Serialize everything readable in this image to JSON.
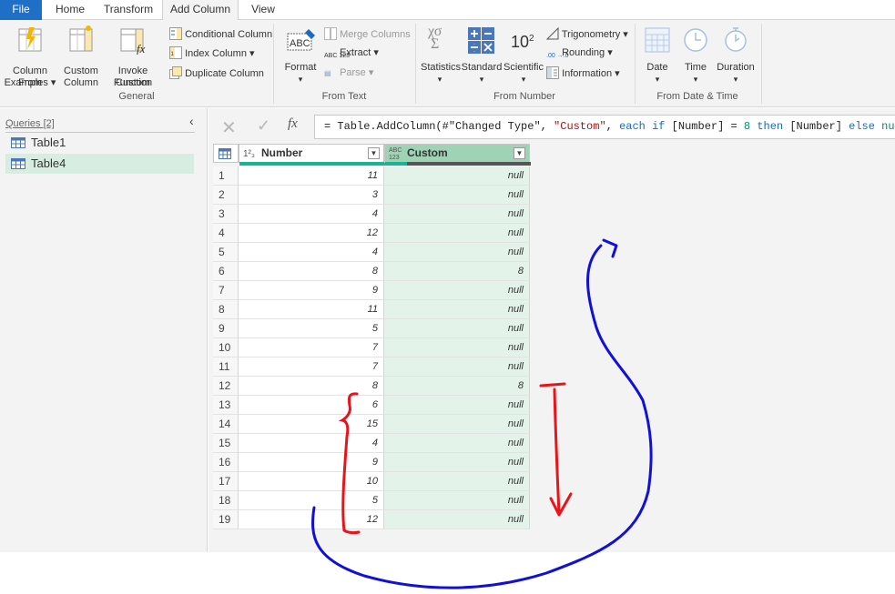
{
  "menu": {
    "tabs": [
      "File",
      "Home",
      "Transform",
      "Add Column",
      "View"
    ]
  },
  "ribbon": {
    "general": {
      "group_label": "General",
      "column_from_examples": [
        "Column From",
        "Examples ▾"
      ],
      "custom_column": [
        "Custom",
        "Column"
      ],
      "invoke_custom_function": [
        "Invoke Custom",
        "Function"
      ],
      "conditional_column": "Conditional Column",
      "index_column": "Index Column ▾",
      "duplicate_column": "Duplicate Column"
    },
    "from_text": {
      "group_label": "From Text",
      "format": "Format",
      "merge_columns": "Merge Columns",
      "extract": "Extract ▾",
      "parse": "Parse ▾"
    },
    "from_number": {
      "group_label": "From Number",
      "statistics": "Statistics",
      "standard": "Standard",
      "scientific": "Scientific",
      "trigonometry": "Trigonometry ▾",
      "rounding": "Rounding ▾",
      "information": "Information ▾"
    },
    "from_date_time": {
      "group_label": "From Date & Time",
      "date": "Date",
      "time": "Time",
      "duration": "Duration"
    }
  },
  "queries": {
    "title": "Queries [2]",
    "items": [
      "Table1",
      "Table4"
    ],
    "selected": "Table4"
  },
  "formula": {
    "prefix": "= Table.AddColumn(#\"Changed Type\", ",
    "custom_str": "\"Custom\"",
    "each_kw": "each if",
    "cond": " [Number] = ",
    "eight": "8",
    "then_kw": "then",
    "then_val": " [Number] ",
    "else_kw": "else",
    "null_kw": "null",
    "suffix": ")"
  },
  "grid": {
    "columns": [
      {
        "name": "Number",
        "type_label": "1²₃"
      },
      {
        "name": "Custom",
        "type_label": "ABC 123"
      }
    ],
    "rows": [
      {
        "n": "1",
        "number": "11",
        "custom": "null"
      },
      {
        "n": "2",
        "number": "3",
        "custom": "null"
      },
      {
        "n": "3",
        "number": "4",
        "custom": "null"
      },
      {
        "n": "4",
        "number": "12",
        "custom": "null"
      },
      {
        "n": "5",
        "number": "4",
        "custom": "null"
      },
      {
        "n": "6",
        "number": "8",
        "custom": "8"
      },
      {
        "n": "7",
        "number": "9",
        "custom": "null"
      },
      {
        "n": "8",
        "number": "11",
        "custom": "null"
      },
      {
        "n": "9",
        "number": "5",
        "custom": "null"
      },
      {
        "n": "10",
        "number": "7",
        "custom": "null"
      },
      {
        "n": "11",
        "number": "7",
        "custom": "null"
      },
      {
        "n": "12",
        "number": "8",
        "custom": "8"
      },
      {
        "n": "13",
        "number": "6",
        "custom": "null"
      },
      {
        "n": "14",
        "number": "15",
        "custom": "null"
      },
      {
        "n": "15",
        "number": "4",
        "custom": "null"
      },
      {
        "n": "16",
        "number": "9",
        "custom": "null"
      },
      {
        "n": "17",
        "number": "10",
        "custom": "null"
      },
      {
        "n": "18",
        "number": "5",
        "custom": "null"
      },
      {
        "n": "19",
        "number": "12",
        "custom": "null"
      }
    ]
  },
  "colors": {
    "file_tab": "#1f6fc6",
    "selected_query": "#d8ede1",
    "custom_header": "#9fd3b5",
    "custom_cells": "#e3f3e9",
    "annotation_red": "#e8141a",
    "annotation_blue": "#1010d8"
  }
}
